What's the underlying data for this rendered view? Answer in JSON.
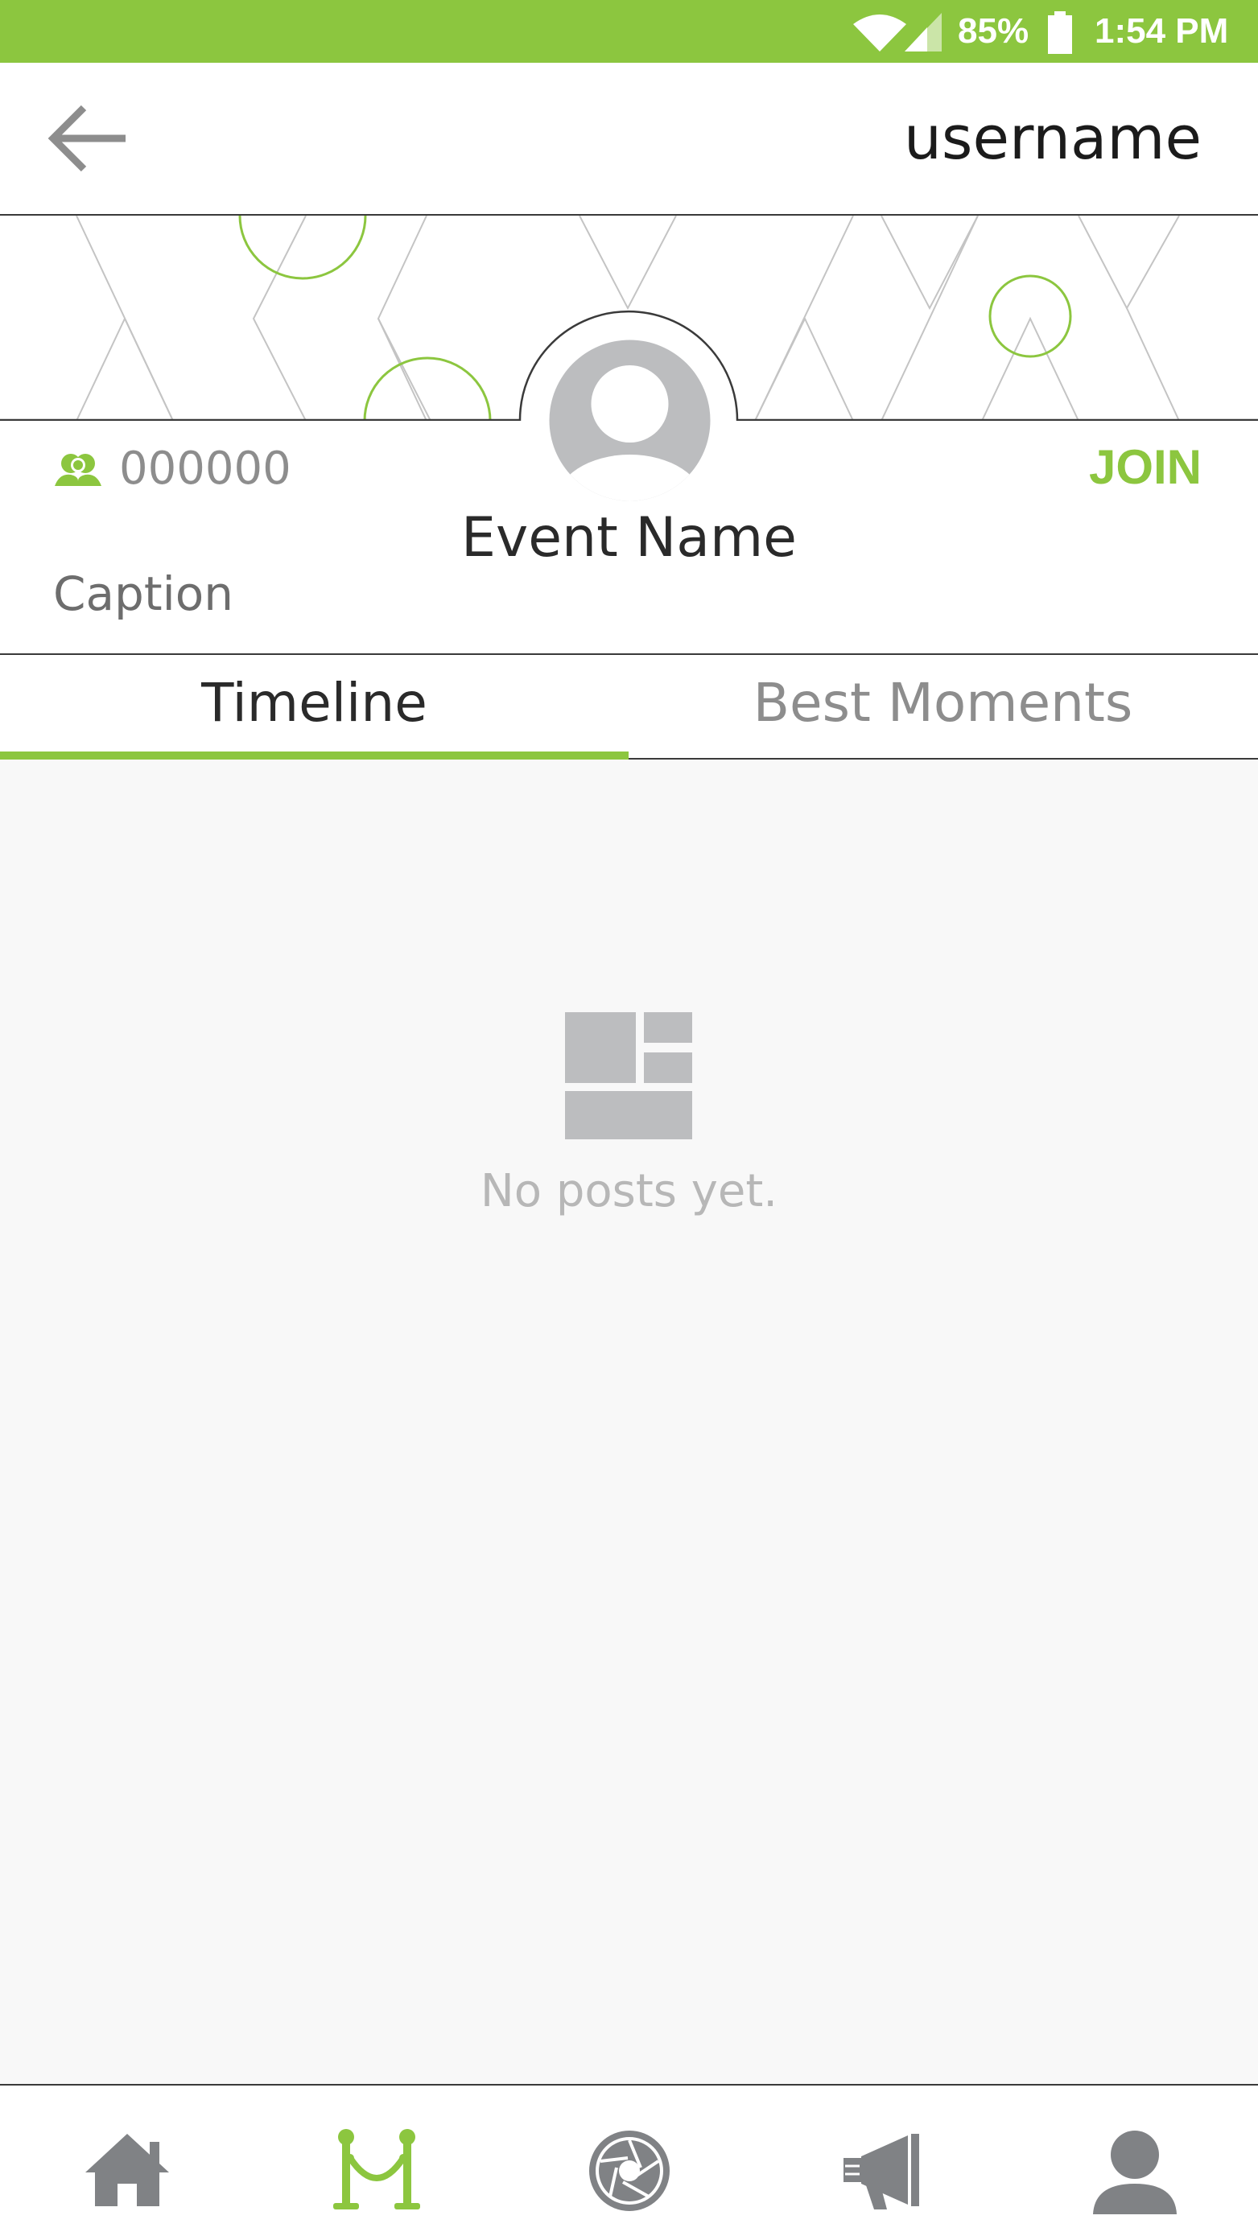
{
  "status_bar": {
    "battery": "85%",
    "time": "1:54 PM",
    "icons": [
      "wifi-icon",
      "signal-icon",
      "battery-icon"
    ]
  },
  "header": {
    "back_icon": "arrow-left-icon",
    "username": "username"
  },
  "event": {
    "member_icon": "members-icon",
    "member_count": "000000",
    "join_label": "JOIN",
    "name": "Event Name",
    "caption": "Caption",
    "avatar_icon": "user-avatar-icon"
  },
  "tabs": [
    {
      "label": "Timeline",
      "active": true
    },
    {
      "label": "Best Moments",
      "active": false
    }
  ],
  "empty_state": {
    "icon": "layout-grid-icon",
    "message": "No posts yet."
  },
  "bottom_nav": [
    {
      "name": "home",
      "icon": "home-icon",
      "active": false
    },
    {
      "name": "events",
      "icon": "stanchion-rope-icon",
      "active": true
    },
    {
      "name": "camera",
      "icon": "camera-aperture-icon",
      "active": false
    },
    {
      "name": "announcements",
      "icon": "megaphone-icon",
      "active": false
    },
    {
      "name": "profile",
      "icon": "profile-icon",
      "active": false
    }
  ],
  "colors": {
    "accent": "#8cc63f",
    "dark_text": "#2a2a2a",
    "muted_text": "#8d8d8d",
    "content_bg": "#f8f8f8",
    "icon_gray": "#bcbdbf"
  }
}
